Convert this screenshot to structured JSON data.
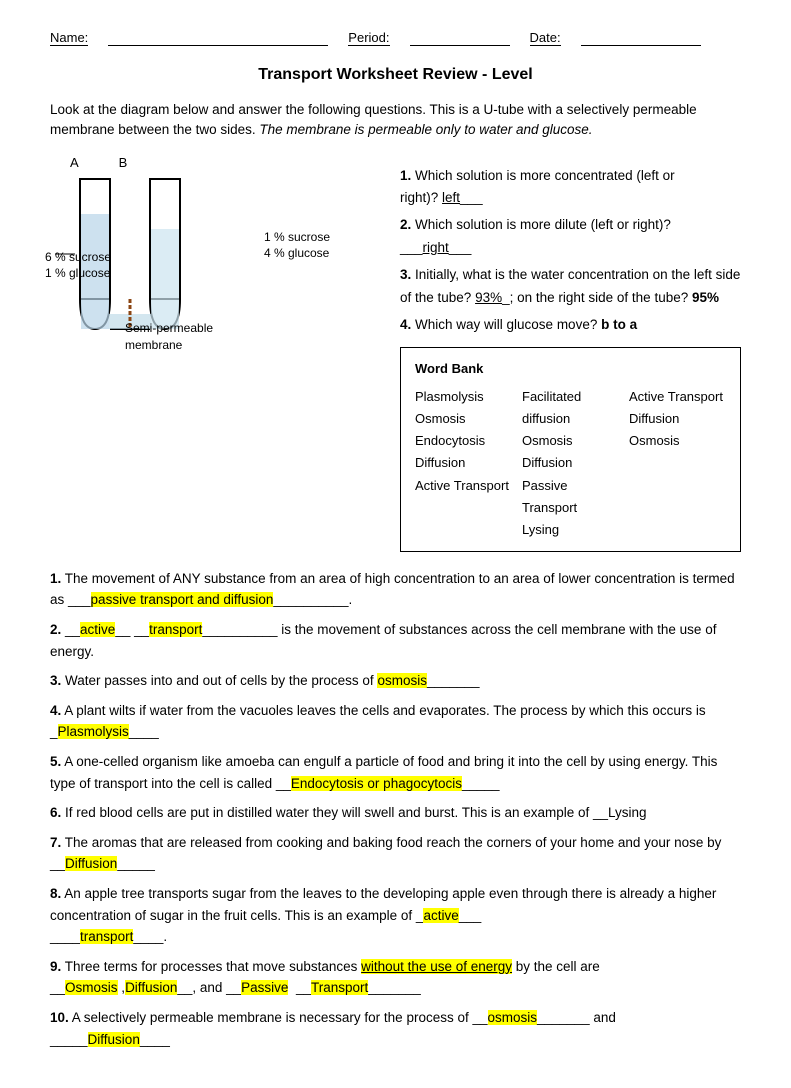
{
  "header": {
    "name_label": "Name:",
    "period_label": "Period:",
    "date_label": "Date:"
  },
  "title": "Transport Worksheet Review - Level",
  "intro": {
    "p1": "Look at the diagram below and answer the following questions.  This is a U-tube with a selectively permeable membrane between the two sides.",
    "p1_italic": " The membrane is permeable only to water and glucose."
  },
  "diagram": {
    "left_label": "A",
    "right_label": "B",
    "side_labels": "6 % sucrose\n1 % glucose",
    "right_side_labels": "1 % sucrose\n4 % glucose",
    "semi_label": "Semi-permeable\nmembrane"
  },
  "questions_q1": {
    "num": "1.",
    "text": "Which solution is more concentrated (left or right)?",
    "answer": " left"
  },
  "questions_q2": {
    "num": "2.",
    "text": "Which solution is more dilute (left or right)?",
    "answer": "right"
  },
  "questions_q3": {
    "num": "3.",
    "text": "Initially, what is the water concentration on the left side of the tube?",
    "answer1": "93%",
    "mid": "; on the right side of the tube?",
    "answer2": "95%"
  },
  "questions_q4": {
    "num": "4.",
    "text": "Which way will glucose move?",
    "answer": "b to a"
  },
  "word_bank": {
    "title": "Word Bank",
    "col1": [
      "Plasmolysis",
      "Osmosis",
      "Endocytosis",
      "Diffusion",
      "Active Transport"
    ],
    "col2": [
      "Facilitated diffusion",
      "Osmosis",
      "Diffusion",
      "Passive Transport",
      "Lysing"
    ],
    "col3": [
      "Active Transport",
      "Diffusion",
      "Osmosis"
    ]
  },
  "main_questions": [
    {
      "num": "1.",
      "text_before": "The movement of ANY substance from an area of high concentration to an area of lower concentration is termed as ___",
      "answer": "passive transport and diffusion",
      "text_after": "__________."
    },
    {
      "num": "2.",
      "text_before": "__",
      "answer1": "active",
      "mid1": "__ __",
      "answer2": "transport",
      "text_after": "__________ is the movement of substances across the cell membrane with the use of energy."
    },
    {
      "num": "3.",
      "text_before": "Water passes into and out of cells by the process of",
      "answer": "osmosis",
      "text_after": "_______"
    },
    {
      "num": "4.",
      "text_before": "A plant wilts if water from the vacuoles leaves the cells and evaporates.  The process by which this occurs is _",
      "answer": "Plasmolysis",
      "text_after": "____"
    },
    {
      "num": "5.",
      "text_before": "A one-celled organism like amoeba can engulf a particle of food and bring it into the cell by using energy.  This type of transport into the cell is called __",
      "answer": "Endocytosis or phagocytocis",
      "text_after": "_____"
    },
    {
      "num": "6.",
      "text_before": "If red blood cells are put in distilled water they will swell and burst.  This is an example of __Lysing"
    },
    {
      "num": "7.",
      "text_before": "The aromas that are released from cooking and baking food reach the corners of your home and your nose by __",
      "answer": "Diffusion",
      "text_after": "_____"
    },
    {
      "num": "8.",
      "text_before": "An apple tree transports sugar from the leaves to the developing apple even through there is already a higher concentration of sugar in the fruit cells. This is an example of _",
      "answer1": "active",
      "mid": "___\n____",
      "answer2": "transport",
      "text_after": "____."
    },
    {
      "num": "9.",
      "text_before": "Three terms for processes that move substances",
      "underline": "without the use of energy",
      "text_mid": "by the cell are\n__",
      "answer1": "Osmosis",
      "mid1": " ,",
      "answer2": "Diffusion",
      "mid2": "__, and __",
      "answer3": "Passive",
      "mid3": "  __",
      "answer4": "Transport",
      "text_after": "_______"
    },
    {
      "num": "10.",
      "text_before": "A selectively permeable membrane is necessary for the process of __",
      "answer1": "osmosis",
      "mid": "_______ and\n_____",
      "answer2": "Diffusion",
      "text_after": "____"
    }
  ]
}
